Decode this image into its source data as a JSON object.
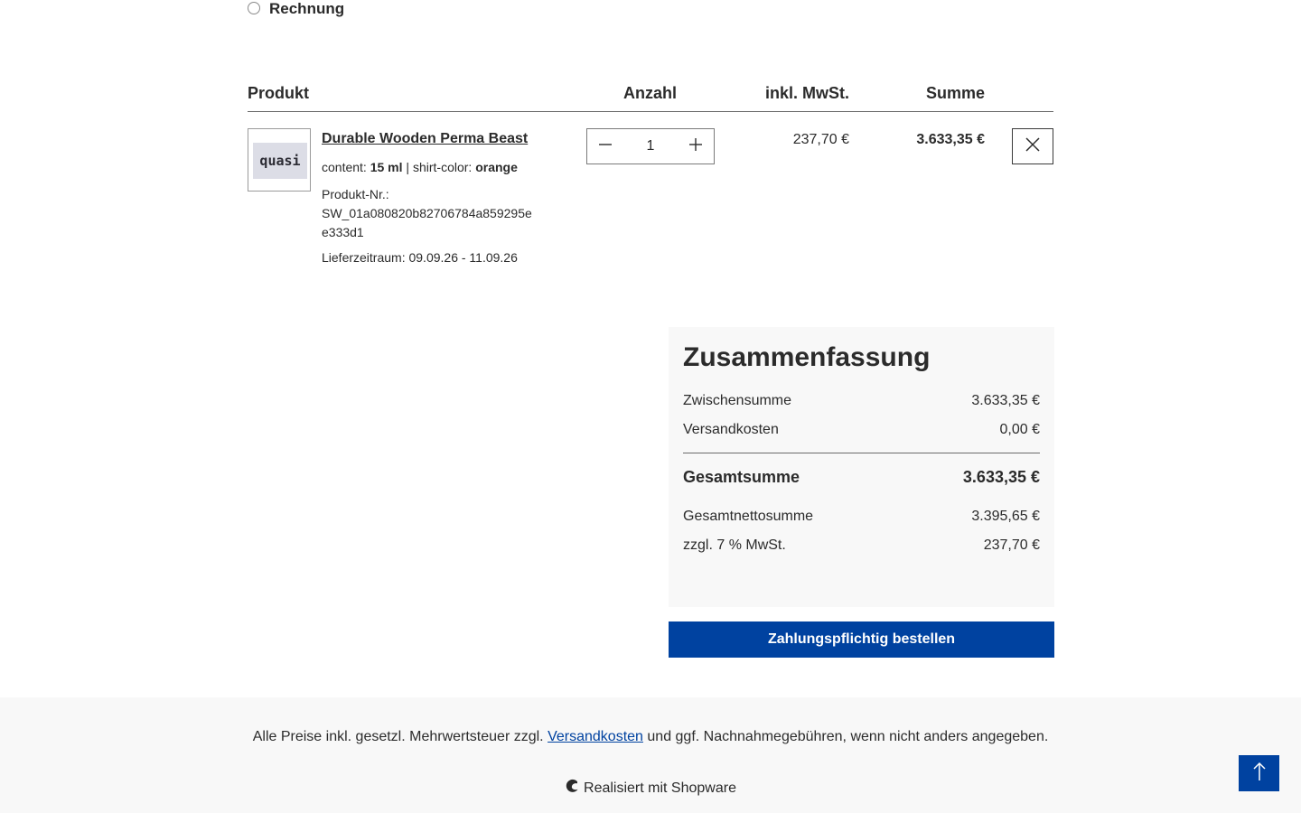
{
  "payment": {
    "option_label": "Rechnung"
  },
  "table": {
    "headers": {
      "product": "Produkt",
      "quantity": "Anzahl",
      "unit_price": "inkl. MwSt.",
      "total": "Summe"
    }
  },
  "line_item": {
    "thumbnail_text": "quasi",
    "name": "Durable Wooden Perma Beast",
    "option1_label": "content:",
    "option1_value": "15 ml",
    "option_separator": "|",
    "option2_label": "shirt-color:",
    "option2_value": "orange",
    "product_number_label": "Produkt-Nr.:",
    "product_number": "SW_01a080820b82706784a859295ee333d1",
    "delivery_label": "Lieferzeitraum:",
    "delivery_range": "09.09.26 - 11.09.26",
    "quantity": "1",
    "unit_price": "237,70 €",
    "total_price": "3.633,35 €"
  },
  "summary": {
    "title": "Zusammenfassung",
    "subtotal_label": "Zwischensumme",
    "subtotal_value": "3.633,35 €",
    "shipping_label": "Versandkosten",
    "shipping_value": "0,00 €",
    "grand_total_label": "Gesamtsumme",
    "grand_total_value": "3.633,35 €",
    "net_total_label": "Gesamtnettosumme",
    "net_total_value": "3.395,65 €",
    "tax_label": "zzgl. 7 % MwSt.",
    "tax_value": "237,70 €"
  },
  "order_button": "Zahlungspflichtig bestellen",
  "footer": {
    "note_prefix": "Alle Preise inkl. gesetzl. Mehrwertsteuer zzgl.",
    "note_link": "Versandkosten",
    "note_suffix": "und ggf. Nachnahmegebühren, wenn nicht anders angegeben.",
    "brand_text": "Realisiert mit Shopware"
  },
  "colors": {
    "primary": "#0042a0",
    "summary_bg": "#f8f8f8",
    "text": "#2b2b2b"
  },
  "icons": [
    "radio-icon",
    "minus-icon",
    "plus-icon",
    "close-icon",
    "shopware-logo-icon",
    "arrow-up-icon"
  ]
}
